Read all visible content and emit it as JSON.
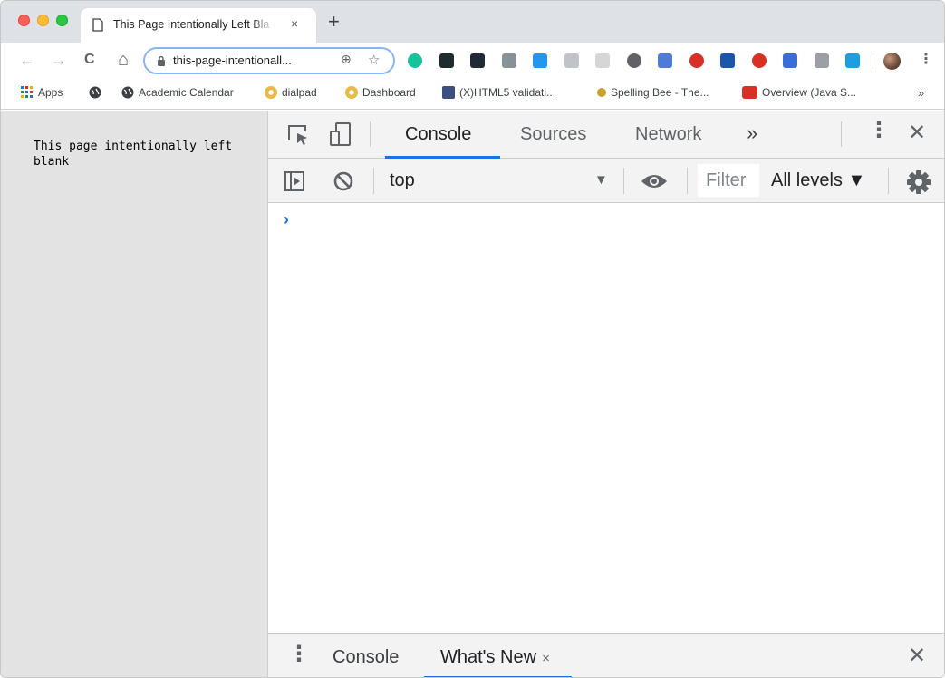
{
  "window": {
    "colors": {
      "close": "#ff5f57",
      "minimize": "#febc2e",
      "zoom": "#28c840"
    }
  },
  "tab": {
    "title": "This Page Intentionally Left Bla",
    "close_glyph": "×",
    "new_tab_glyph": "+"
  },
  "toolbar": {
    "back_glyph": "←",
    "forward_glyph": "→",
    "reload_glyph": "C",
    "home_glyph": "⌂",
    "url": "this-page-intentionall...",
    "zoom_glyph": "⊕",
    "star_glyph": "☆",
    "menu_glyph": "⋮",
    "extensions": [
      {
        "name": "grammarly",
        "color": "#15c39a"
      },
      {
        "name": "terminal",
        "color": "#1e2b2f"
      },
      {
        "name": "vimium",
        "color": "#1f2a36"
      },
      {
        "name": "ext-badge",
        "color": "#8a9099"
      },
      {
        "name": "toggle",
        "color": "#2196f3"
      },
      {
        "name": "ext-gray",
        "color": "#c0c4c8"
      },
      {
        "name": "es",
        "color": "#d6d6d6"
      },
      {
        "name": "circle",
        "color": "#5f6368"
      },
      {
        "name": "pencil",
        "color": "#4f7bd6"
      },
      {
        "name": "red-play",
        "color": "#d93025"
      },
      {
        "name": "blue-square",
        "color": "#1a56b0"
      },
      {
        "name": "ublock",
        "color": "#d93025"
      },
      {
        "name": "blue-yellow",
        "color": "#3b6dd8"
      },
      {
        "name": "notion",
        "color": "#9aa0a6"
      },
      {
        "name": "s-ext",
        "color": "#1a9fe0"
      }
    ]
  },
  "bookmarks": {
    "items": [
      {
        "label": "Apps",
        "color": "#1a73e8"
      },
      {
        "label": "",
        "color": "#3c4043"
      },
      {
        "label": "Academic Calendar",
        "color": "#3c4043"
      },
      {
        "label": "dialpad",
        "color": "#e9b949"
      },
      {
        "label": "Dashboard",
        "color": "#e9b949"
      },
      {
        "label": "(X)HTML5 validati...",
        "color": "#3b4f80"
      },
      {
        "label": "Spelling Bee - The...",
        "color": "#c8a02a"
      },
      {
        "label": "Overview (Java S...",
        "color": "#d93025"
      }
    ],
    "more_glyph": "»"
  },
  "page": {
    "text": "This page intentionally left blank"
  },
  "devtools": {
    "tabs": [
      "Console",
      "Sources",
      "Network"
    ],
    "more_glyph": "»",
    "kebab_glyph": "⋮",
    "close_glyph": "✕",
    "context": "top",
    "context_arrow": "▼",
    "filter_placeholder": "Filter",
    "levels": "All levels ▼",
    "prompt_glyph": "›",
    "drawer": {
      "kebab_glyph": "⋮",
      "tabs": [
        {
          "label": "Console"
        },
        {
          "label": "What's New",
          "close_glyph": "×"
        }
      ],
      "close_glyph": "✕"
    }
  }
}
